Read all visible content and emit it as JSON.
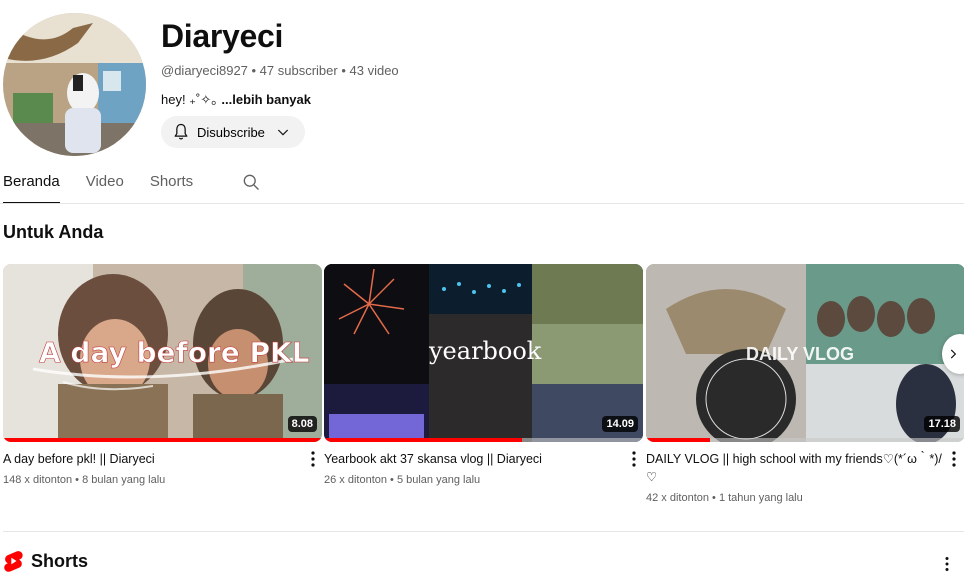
{
  "channel": {
    "name": "Diaryeci",
    "meta": "@diaryeci8927 • 47 subscriber • 43 video",
    "description": "hey! ₊˚✧｡ ",
    "more_label": "...lebih banyak",
    "subscribe_label": "Disubscribe"
  },
  "tabs": [
    {
      "label": "Beranda",
      "active": true
    },
    {
      "label": "Video",
      "active": false
    },
    {
      "label": "Shorts",
      "active": false
    }
  ],
  "section": {
    "title": "Untuk Anda"
  },
  "videos": [
    {
      "title": "A day before pkl! || Diaryeci",
      "meta": "148 x ditonton • 8 bulan yang lalu",
      "duration": "8.08",
      "thumb_text": "A day before PKL",
      "watched_fraction": 1.0
    },
    {
      "title": "Yearbook akt 37 skansa vlog || Diaryeci",
      "meta": "26 x ditonton • 5 bulan yang lalu",
      "duration": "14.09",
      "thumb_text": "yearbook",
      "watched_fraction": 0.62
    },
    {
      "title": "DAILY VLOG || high school with my friends♡(*´ω｀*)/ ♡",
      "meta": "42 x ditonton • 1 tahun yang lalu",
      "duration": "17.18",
      "thumb_text": "DAILY VLOG",
      "watched_fraction": 0.2
    }
  ],
  "shorts": {
    "title": "Shorts"
  },
  "icons": {
    "bell": "bell-icon",
    "chevron": "chevron-down-icon",
    "search": "search-icon",
    "more": "more-vert-icon",
    "next": "chevron-right-icon",
    "shorts": "shorts-logo-icon"
  },
  "colors": {
    "accent": "#ff0000",
    "text": "#0f0f0f",
    "muted": "#606060"
  }
}
